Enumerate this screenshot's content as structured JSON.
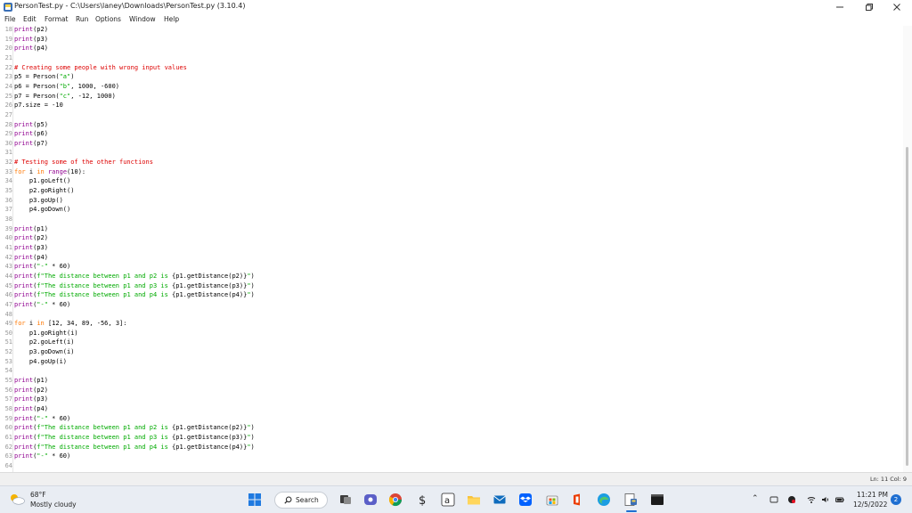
{
  "window": {
    "title": "PersonTest.py - C:\\Users\\laney\\Downloads\\PersonTest.py (3.10.4)"
  },
  "menu": [
    "File",
    "Edit",
    "Format",
    "Run",
    "Options",
    "Window",
    "Help"
  ],
  "editor": {
    "lines": [
      {
        "n": "18",
        "code": [
          [
            "bi",
            "print"
          ],
          [
            "",
            "(p2)"
          ]
        ]
      },
      {
        "n": "19",
        "code": [
          [
            "bi",
            "print"
          ],
          [
            "",
            "(p3)"
          ]
        ]
      },
      {
        "n": "20",
        "code": [
          [
            "bi",
            "print"
          ],
          [
            "",
            "(p4)"
          ]
        ]
      },
      {
        "n": "21",
        "code": []
      },
      {
        "n": "22",
        "code": [
          [
            "cm",
            "# Creating some people with wrong input values"
          ]
        ]
      },
      {
        "n": "23",
        "code": [
          [
            "",
            "p5 = Person("
          ],
          [
            "str",
            "\"a\""
          ],
          [
            "",
            ")"
          ]
        ]
      },
      {
        "n": "24",
        "code": [
          [
            "",
            "p6 = Person("
          ],
          [
            "str",
            "\"b\""
          ],
          [
            "",
            ", 1000, -600)"
          ]
        ]
      },
      {
        "n": "25",
        "code": [
          [
            "",
            "p7 = Person("
          ],
          [
            "str",
            "\"c\""
          ],
          [
            "",
            ", -12, 1000)"
          ]
        ]
      },
      {
        "n": "26",
        "code": [
          [
            "",
            "p7.size = -10"
          ]
        ]
      },
      {
        "n": "27",
        "code": []
      },
      {
        "n": "28",
        "code": [
          [
            "bi",
            "print"
          ],
          [
            "",
            "(p5)"
          ]
        ]
      },
      {
        "n": "29",
        "code": [
          [
            "bi",
            "print"
          ],
          [
            "",
            "(p6)"
          ]
        ]
      },
      {
        "n": "30",
        "code": [
          [
            "bi",
            "print"
          ],
          [
            "",
            "(p7)"
          ]
        ]
      },
      {
        "n": "31",
        "code": []
      },
      {
        "n": "32",
        "code": [
          [
            "cm",
            "# Testing some of the other functions"
          ]
        ]
      },
      {
        "n": "33",
        "code": [
          [
            "kw",
            "for"
          ],
          [
            "",
            " i "
          ],
          [
            "kw",
            "in"
          ],
          [
            "",
            " "
          ],
          [
            "bi",
            "range"
          ],
          [
            "",
            "(10):"
          ]
        ]
      },
      {
        "n": "34",
        "code": [
          [
            "",
            "    p1.goLeft()"
          ]
        ]
      },
      {
        "n": "35",
        "code": [
          [
            "",
            "    p2.goRight()"
          ]
        ]
      },
      {
        "n": "36",
        "code": [
          [
            "",
            "    p3.goUp()"
          ]
        ]
      },
      {
        "n": "37",
        "code": [
          [
            "",
            "    p4.goDown()"
          ]
        ]
      },
      {
        "n": "38",
        "code": []
      },
      {
        "n": "39",
        "code": [
          [
            "bi",
            "print"
          ],
          [
            "",
            "(p1)"
          ]
        ]
      },
      {
        "n": "40",
        "code": [
          [
            "bi",
            "print"
          ],
          [
            "",
            "(p2)"
          ]
        ]
      },
      {
        "n": "41",
        "code": [
          [
            "bi",
            "print"
          ],
          [
            "",
            "(p3)"
          ]
        ]
      },
      {
        "n": "42",
        "code": [
          [
            "bi",
            "print"
          ],
          [
            "",
            "(p4)"
          ]
        ]
      },
      {
        "n": "43",
        "code": [
          [
            "bi",
            "print"
          ],
          [
            "",
            "("
          ],
          [
            "str",
            "\"-\""
          ],
          [
            "",
            " * 60)"
          ]
        ]
      },
      {
        "n": "44",
        "code": [
          [
            "bi",
            "print"
          ],
          [
            "",
            "("
          ],
          [
            "str",
            "f\"The distance between p1 and p2 is "
          ],
          [
            "",
            "{p1.getDistance(p2)}"
          ],
          [
            "str",
            "\""
          ],
          [
            "",
            ")"
          ]
        ]
      },
      {
        "n": "45",
        "code": [
          [
            "bi",
            "print"
          ],
          [
            "",
            "("
          ],
          [
            "str",
            "f\"The distance between p1 and p3 is "
          ],
          [
            "",
            "{p1.getDistance(p3)}"
          ],
          [
            "str",
            "\""
          ],
          [
            "",
            ")"
          ]
        ]
      },
      {
        "n": "46",
        "code": [
          [
            "bi",
            "print"
          ],
          [
            "",
            "("
          ],
          [
            "str",
            "f\"The distance between p1 and p4 is "
          ],
          [
            "",
            "{p1.getDistance(p4)}"
          ],
          [
            "str",
            "\""
          ],
          [
            "",
            ")"
          ]
        ]
      },
      {
        "n": "47",
        "code": [
          [
            "bi",
            "print"
          ],
          [
            "",
            "("
          ],
          [
            "str",
            "\"-\""
          ],
          [
            "",
            " * 60)"
          ]
        ]
      },
      {
        "n": "48",
        "code": []
      },
      {
        "n": "49",
        "code": [
          [
            "kw",
            "for"
          ],
          [
            "",
            " i "
          ],
          [
            "kw",
            "in"
          ],
          [
            "",
            " [12, 34, 89, -56, 3]:"
          ]
        ]
      },
      {
        "n": "50",
        "code": [
          [
            "",
            "    p1.goRight(i)"
          ]
        ]
      },
      {
        "n": "51",
        "code": [
          [
            "",
            "    p2.goLeft(i)"
          ]
        ]
      },
      {
        "n": "52",
        "code": [
          [
            "",
            "    p3.goDown(i)"
          ]
        ]
      },
      {
        "n": "53",
        "code": [
          [
            "",
            "    p4.goUp(i)"
          ]
        ]
      },
      {
        "n": "54",
        "code": []
      },
      {
        "n": "55",
        "code": [
          [
            "bi",
            "print"
          ],
          [
            "",
            "(p1)"
          ]
        ]
      },
      {
        "n": "56",
        "code": [
          [
            "bi",
            "print"
          ],
          [
            "",
            "(p2)"
          ]
        ]
      },
      {
        "n": "57",
        "code": [
          [
            "bi",
            "print"
          ],
          [
            "",
            "(p3)"
          ]
        ]
      },
      {
        "n": "58",
        "code": [
          [
            "bi",
            "print"
          ],
          [
            "",
            "(p4)"
          ]
        ]
      },
      {
        "n": "59",
        "code": [
          [
            "bi",
            "print"
          ],
          [
            "",
            "("
          ],
          [
            "str",
            "\"-\""
          ],
          [
            "",
            " * 60)"
          ]
        ]
      },
      {
        "n": "60",
        "code": [
          [
            "bi",
            "print"
          ],
          [
            "",
            "("
          ],
          [
            "str",
            "f\"The distance between p1 and p2 is "
          ],
          [
            "",
            "{p1.getDistance(p2)}"
          ],
          [
            "str",
            "\""
          ],
          [
            "",
            ")"
          ]
        ]
      },
      {
        "n": "61",
        "code": [
          [
            "bi",
            "print"
          ],
          [
            "",
            "("
          ],
          [
            "str",
            "f\"The distance between p1 and p3 is "
          ],
          [
            "",
            "{p1.getDistance(p3)}"
          ],
          [
            "str",
            "\""
          ],
          [
            "",
            ")"
          ]
        ]
      },
      {
        "n": "62",
        "code": [
          [
            "bi",
            "print"
          ],
          [
            "",
            "("
          ],
          [
            "str",
            "f\"The distance between p1 and p4 is "
          ],
          [
            "",
            "{p1.getDistance(p4)}"
          ],
          [
            "str",
            "\""
          ],
          [
            "",
            ")"
          ]
        ]
      },
      {
        "n": "63",
        "code": [
          [
            "bi",
            "print"
          ],
          [
            "",
            "("
          ],
          [
            "str",
            "\"-\""
          ],
          [
            "",
            " * 60)"
          ]
        ]
      },
      {
        "n": "64",
        "code": []
      }
    ]
  },
  "status": {
    "position": "Ln: 11   Col: 9"
  },
  "taskbar": {
    "weather_temp": "68°F",
    "weather_desc": "Mostly cloudy",
    "search_label": "Search",
    "time": "11:21 PM",
    "date": "12/5/2022",
    "notification_count": "2"
  },
  "colors": {
    "keyword": "#ff7700",
    "builtin": "#900090",
    "string": "#00aa00",
    "comment": "#dd0000"
  }
}
